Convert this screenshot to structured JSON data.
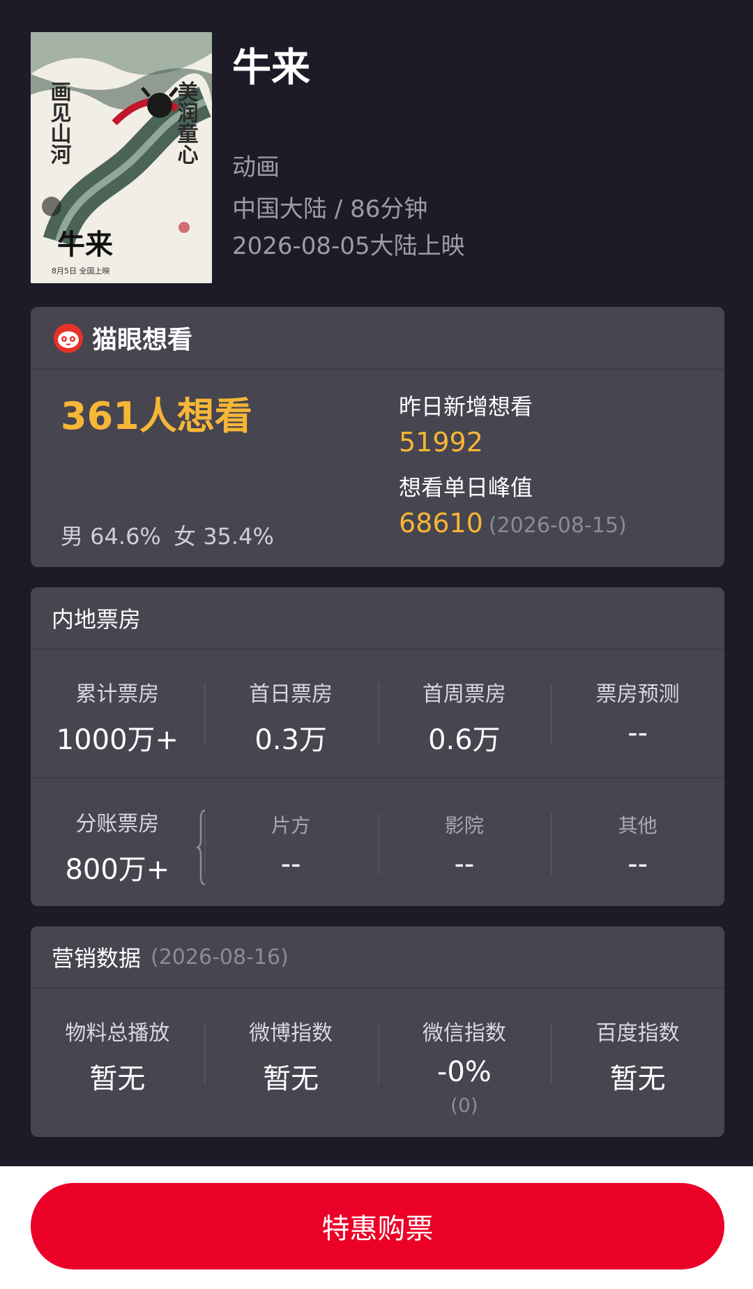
{
  "movie": {
    "title": "牛来",
    "genre": "动画",
    "meta": "中国大陆 / 86分钟",
    "release": "2026-08-05大陆上映",
    "poster": {
      "title_text": "牛来",
      "slogan_1": "美润童心",
      "slogan_2": "画见山河",
      "date_text": "8月5日  全国上映"
    }
  },
  "want_card": {
    "brand_name": "猫眼想看",
    "total": "361人想看",
    "gender_male": "男 64.6%",
    "gender_female": "女 35.4%",
    "yesterday_label": "昨日新增想看",
    "yesterday_value": "51992",
    "peak_label": "想看单日峰值",
    "peak_value": "68610",
    "peak_date": "(2026-08-15)"
  },
  "box_office": {
    "title": "内地票房",
    "row1": [
      {
        "label": "累计票房",
        "value": "1000万+"
      },
      {
        "label": "首日票房",
        "value": "0.3万"
      },
      {
        "label": "首周票房",
        "value": "0.6万"
      },
      {
        "label": "票房预测",
        "value": "--"
      }
    ],
    "split": {
      "label": "分账票房",
      "value": "800万+"
    },
    "row2": [
      {
        "label": "片方",
        "value": "--"
      },
      {
        "label": "影院",
        "value": "--"
      },
      {
        "label": "其他",
        "value": "--"
      }
    ]
  },
  "marketing": {
    "title": "营销数据",
    "date": "(2026-08-16)",
    "items": [
      {
        "label": "物料总播放",
        "value": "暂无"
      },
      {
        "label": "微博指数",
        "value": "暂无"
      },
      {
        "label": "微信指数",
        "value": "-0%",
        "sub": "(0)"
      },
      {
        "label": "百度指数",
        "value": "暂无"
      }
    ]
  },
  "footer": {
    "buy_label": "特惠购票"
  },
  "colors": {
    "background": "#1c1b27",
    "card": "#464550",
    "accent_gold": "#f6b636",
    "brand_red": "#eb0028"
  }
}
